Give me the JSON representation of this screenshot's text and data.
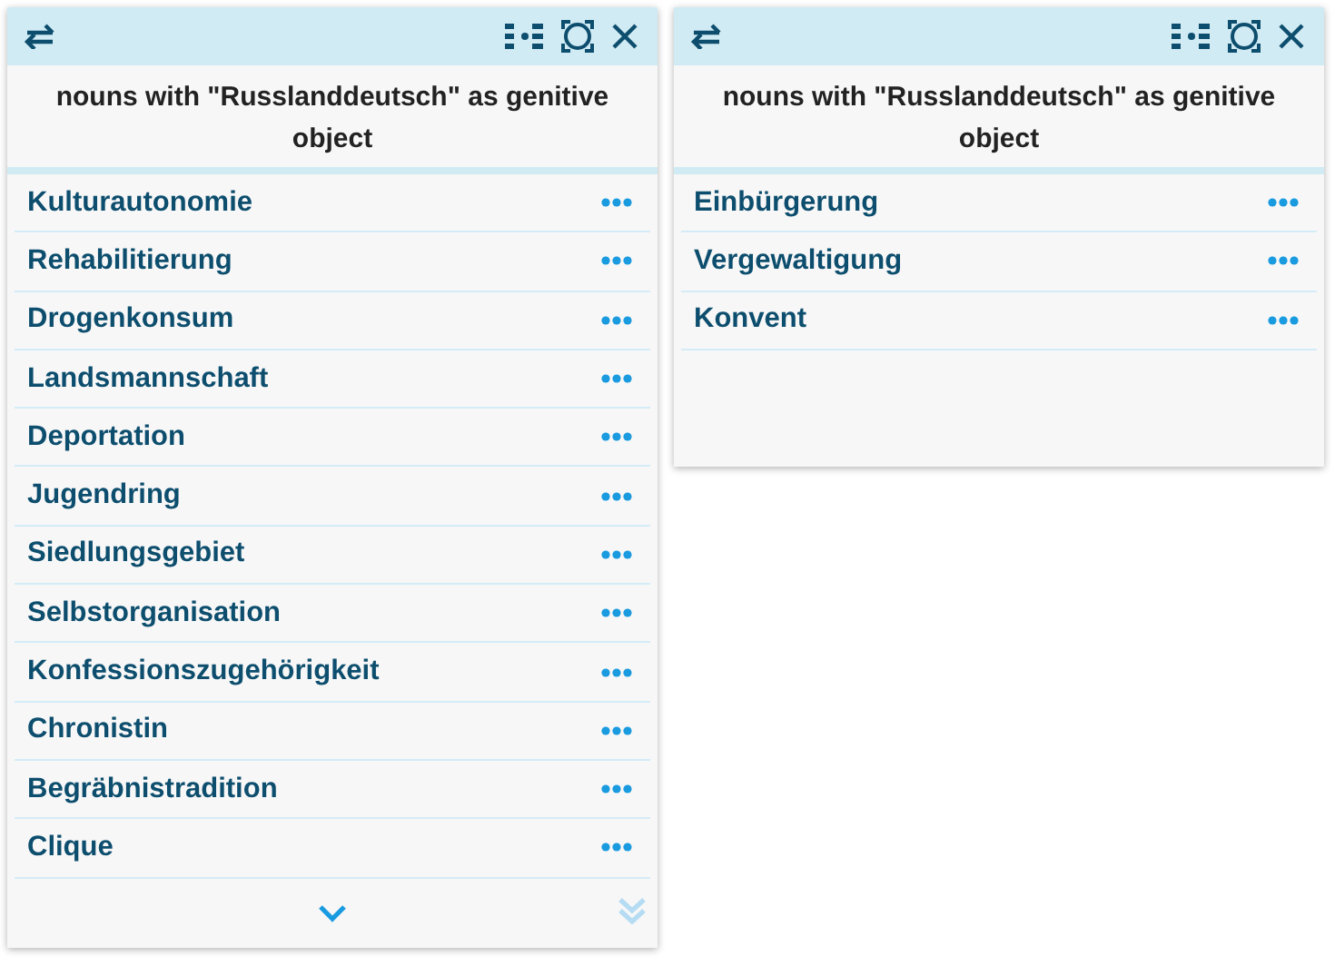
{
  "panels": [
    {
      "title": "nouns with \"Russlanddeutsch\" as genitive object",
      "show_more": true,
      "items": [
        "Kulturautonomie",
        "Rehabilitierung",
        "Drogenkonsum",
        "Landsmannschaft",
        "Deportation",
        "Jugendring",
        "Siedlungsgebiet",
        "Selbstorganisation",
        "Konfessionszugehörigkeit",
        "Chronistin",
        "Begräbnistradition",
        "Clique"
      ]
    },
    {
      "title": "nouns with \"Russlanddeutsch\" as genitive object",
      "show_more": false,
      "items": [
        "Einbürgerung",
        "Vergewaltigung",
        "Konvent"
      ]
    }
  ]
}
